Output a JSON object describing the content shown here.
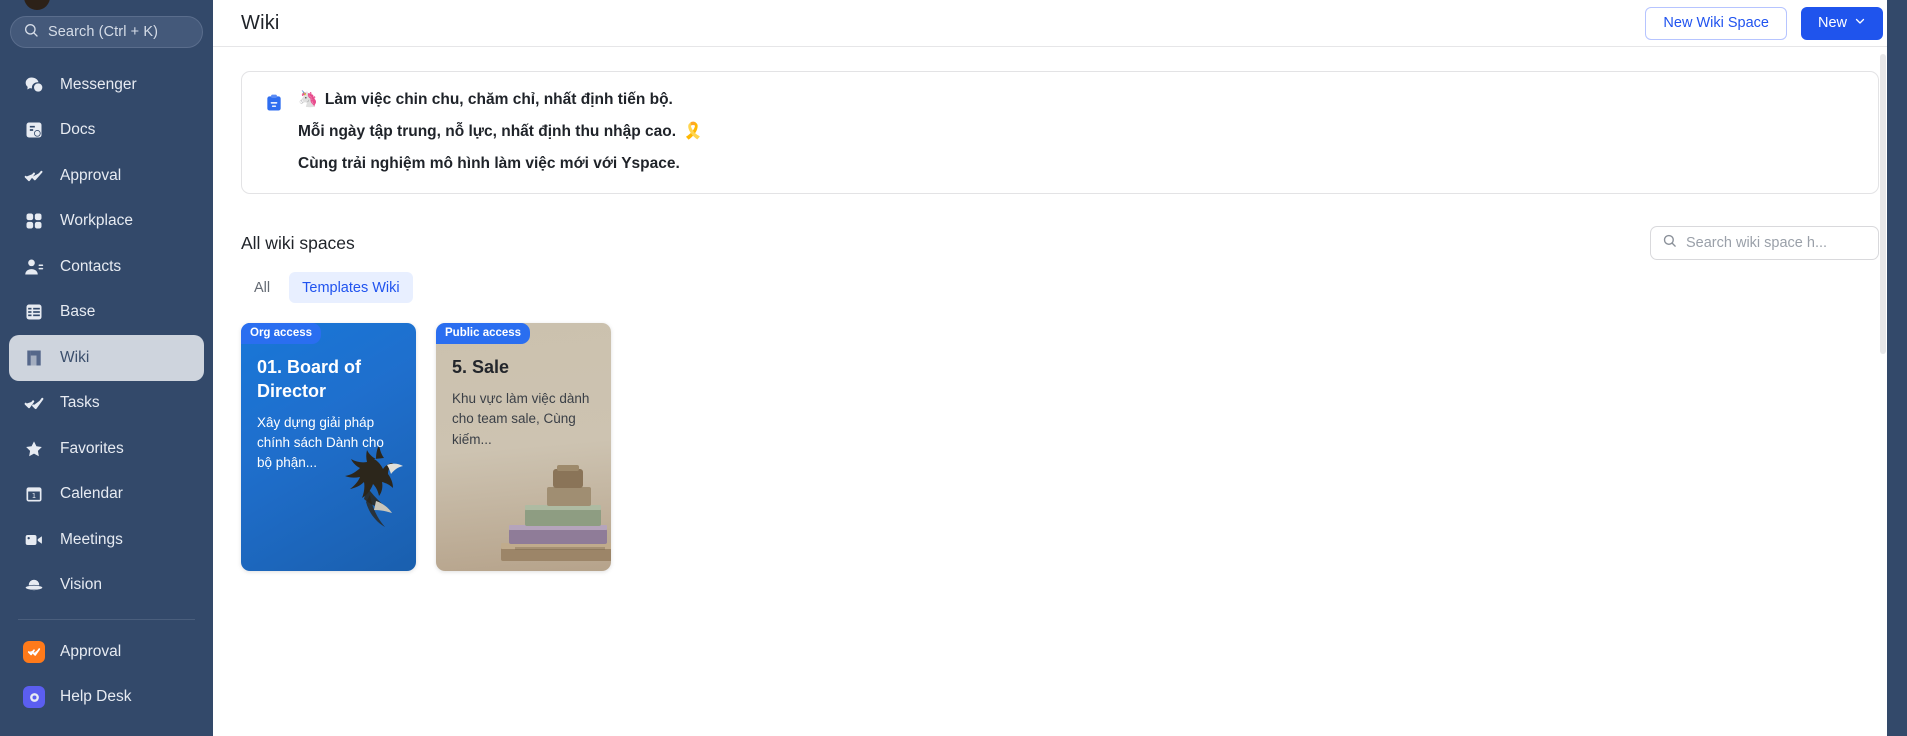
{
  "sidebar": {
    "search": {
      "label": "Search (Ctrl + K)",
      "icon": "search-icon"
    },
    "items": [
      {
        "label": "Messenger",
        "icon": "messenger-icon",
        "active": false
      },
      {
        "label": "Docs",
        "icon": "docs-icon",
        "active": false
      },
      {
        "label": "Approval",
        "icon": "approval-check-icon",
        "active": false
      },
      {
        "label": "Workplace",
        "icon": "workplace-grid-icon",
        "active": false
      },
      {
        "label": "Contacts",
        "icon": "contacts-person-icon",
        "active": false
      },
      {
        "label": "Base",
        "icon": "base-table-icon",
        "active": false
      },
      {
        "label": "Wiki",
        "icon": "wiki-book-icon",
        "active": true
      },
      {
        "label": "Tasks",
        "icon": "tasks-check-icon",
        "active": false
      },
      {
        "label": "Favorites",
        "icon": "favorites-star-icon",
        "active": false
      },
      {
        "label": "Calendar",
        "icon": "calendar-icon",
        "active": false
      },
      {
        "label": "Meetings",
        "icon": "meetings-video-icon",
        "active": false
      },
      {
        "label": "Vision",
        "icon": "vision-saturn-icon",
        "active": false
      }
    ],
    "apps": [
      {
        "label": "Approval",
        "icon": "approval-app-icon",
        "color": "#ff7a1a"
      },
      {
        "label": "Help Desk",
        "icon": "help-desk-app-icon",
        "color": "#5b5ef0"
      }
    ]
  },
  "header": {
    "title": "Wiki",
    "new_wiki_space_label": "New Wiki Space",
    "new_label": "New",
    "new_caret_icon": "chevron-down-icon"
  },
  "banner": {
    "icon": "clipboard-blue-icon",
    "lines": [
      {
        "emoji": "🦄",
        "text": "Làm việc chin chu, chăm chỉ, nhất định tiến bộ.",
        "emoji_after": ""
      },
      {
        "emoji": "",
        "text": "Mỗi ngày tập trung, nỗ lực, nhất định thu nhập cao.",
        "emoji_after": "🎗️"
      },
      {
        "emoji": "",
        "text": "Cùng trải nghiệm mô hình làm việc mới với Yspace.",
        "emoji_after": ""
      }
    ]
  },
  "spaces_section": {
    "title": "All wiki spaces",
    "search_placeholder": "Search wiki space h...",
    "search_value": "",
    "search_icon": "search-icon",
    "tabs": [
      {
        "label": "All",
        "active": false
      },
      {
        "label": "Templates Wiki",
        "active": true
      }
    ],
    "cards": [
      {
        "badge": "Org access",
        "title": "01. Board of Director",
        "description": "Xây dựng giải pháp chính sách Dành cho bộ phận...",
        "art": "eagle-illustration"
      },
      {
        "badge": "Public access",
        "title": "5. Sale",
        "description": "Khu vực làm việc dành cho team sale, Cùng kiếm...",
        "art": "books-illustration"
      }
    ]
  },
  "colors": {
    "sidebar_bg": "#33496a",
    "primary_blue": "#1f54ed",
    "tab_active_bg": "#e8efff",
    "tab_active_text": "#2053ef",
    "badge_blue": "#2a6ef0",
    "card1_gradient_from": "#1877d8",
    "card1_gradient_to": "#1a5fae",
    "card2_bg": "#cbc1ae"
  }
}
